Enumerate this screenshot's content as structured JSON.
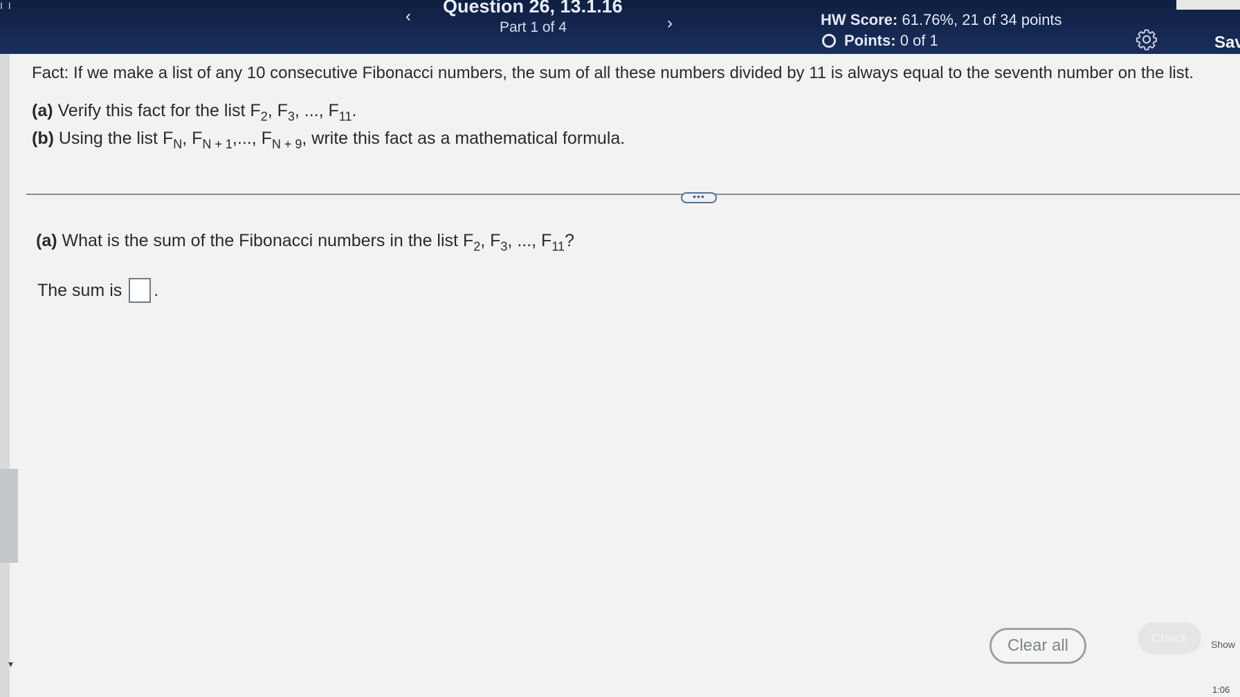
{
  "header": {
    "left_mark": "I I",
    "question_title": "Question 26, 13.1.16",
    "part_label": "Part 1 of 4",
    "hw_score_label": "HW Score:",
    "hw_score_value": "61.76%, 21 of 34 points",
    "points_label": "Points:",
    "points_value": "0 of 1",
    "save_label": "Sav",
    "prev_glyph": "‹",
    "next_glyph": "›"
  },
  "problem": {
    "fact": "Fact: If we make a list of any 10 consecutive Fibonacci numbers, the sum of all these numbers divided by 11 is always equal to the seventh number on the list.",
    "a_label": "(a)",
    "a_text": "Verify this fact for the list ",
    "a_list": [
      "F",
      "2",
      ", F",
      "3",
      ", ..., F",
      "11",
      "."
    ],
    "b_label": "(b)",
    "b_text": "Using the list ",
    "b_list": [
      "F",
      "N",
      ", F",
      "N + 1",
      ",..., F",
      "N + 9",
      ", write this fact as a mathematical formula."
    ]
  },
  "divider": {
    "handle_glyph": "•••"
  },
  "question": {
    "label": "(a)",
    "text": "What is the sum of the Fibonacci numbers in the list ",
    "list": [
      "F",
      "2",
      ", F",
      "3",
      ", ..., F",
      "11",
      "?"
    ],
    "answer_prefix": "The sum is",
    "answer_value": "",
    "answer_suffix": "."
  },
  "footer": {
    "clear_all_label": "Clear all",
    "check_label": "Check",
    "show_label": "Show",
    "clock": "1:06"
  },
  "colors": {
    "header_bg": "#1a2e5c",
    "page_bg": "#f2f2f0"
  }
}
